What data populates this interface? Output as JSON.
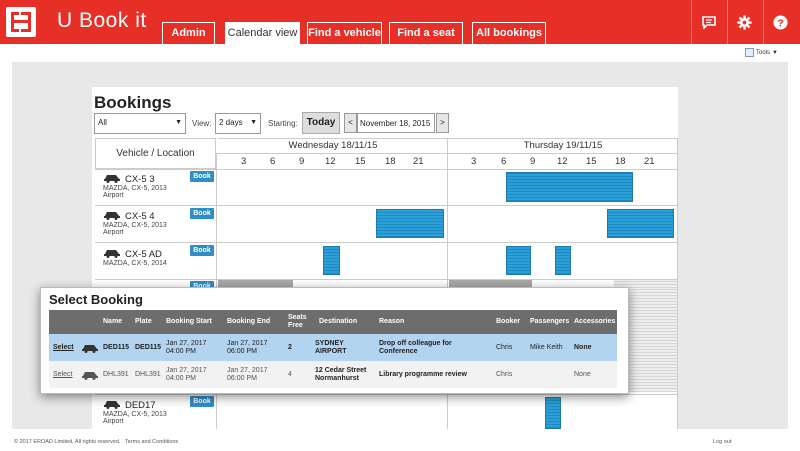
{
  "header": {
    "app_title": "U Book it",
    "tabs": [
      {
        "label": "Admin"
      },
      {
        "label": "Calendar view"
      },
      {
        "label": "Find a vehicle"
      },
      {
        "label": "Find a seat"
      },
      {
        "label": "All bookings"
      }
    ],
    "icons": [
      "chat-icon",
      "gear-icon",
      "help-icon"
    ]
  },
  "tools": {
    "label": "Tools"
  },
  "bookings": {
    "title": "Bookings",
    "filter_value": "All",
    "view_label": "View:",
    "view_value": "2 days",
    "starting_label": "Starting:",
    "today_label": "Today",
    "prev_label": "<",
    "next_label": ">",
    "date_value": "November 18, 2015"
  },
  "schedule": {
    "vehicle_header": "Vehicle / Location",
    "days": [
      {
        "label": "Wednesday 18/11/15",
        "hours": [
          "3",
          "6",
          "9",
          "12",
          "15",
          "18",
          "21"
        ]
      },
      {
        "label": "Thursday 19/11/15",
        "hours": [
          "3",
          "6",
          "9",
          "12",
          "15",
          "18",
          "21"
        ]
      }
    ],
    "book_label": "Book",
    "vehicles": [
      {
        "name": "CX-5 3",
        "model": "MAZDA, CX-5, 2013",
        "location": "Airport"
      },
      {
        "name": "CX-5 4",
        "model": "MAZDA, CX-5, 2013",
        "location": "Airport"
      },
      {
        "name": "CX-5 AD",
        "model": "MAZDA, CX-5, 2014",
        "location": ""
      },
      {
        "name": "DED17",
        "model": "MAZDA, CX-5, 2013",
        "location": "Airport"
      }
    ]
  },
  "modal": {
    "title": "Select Booking",
    "columns": [
      "",
      "",
      "Name",
      "Plate",
      "Booking Start",
      "Booking End",
      "Seats Free",
      "Destination",
      "Reason",
      "Booker",
      "Passengers",
      "Accessories"
    ],
    "rows": [
      {
        "action": "Select",
        "name": "DED115",
        "plate": "DED115",
        "start": "Jan 27, 2017 04:00 PM",
        "end": "Jan 27, 2017 06:00 PM",
        "seats": "2",
        "destination": "SYDNEY AIRPORT",
        "reason": "Drop off colleague for Conference",
        "booker": "Chris",
        "passengers": "Mike Keith",
        "accessories": "None"
      },
      {
        "action": "Select",
        "name": "DHL391",
        "plate": "DHL391",
        "start": "Jan 27, 2017 04:00 PM",
        "end": "Jan 27, 2017 06:00 PM",
        "seats": "4",
        "destination": "12 Cedar Street Normanhurst",
        "reason": "Library programme review",
        "booker": "Chris",
        "passengers": "",
        "accessories": "None"
      }
    ]
  },
  "footer": {
    "copyright": "© 2017 EROAD Limited, All rights reserved.",
    "terms": "Terms and Conditions",
    "logout": "Log out"
  },
  "colors": {
    "brand": "#e63027",
    "booking": "#2ba0d8",
    "selected_row": "#b3d4f1"
  }
}
